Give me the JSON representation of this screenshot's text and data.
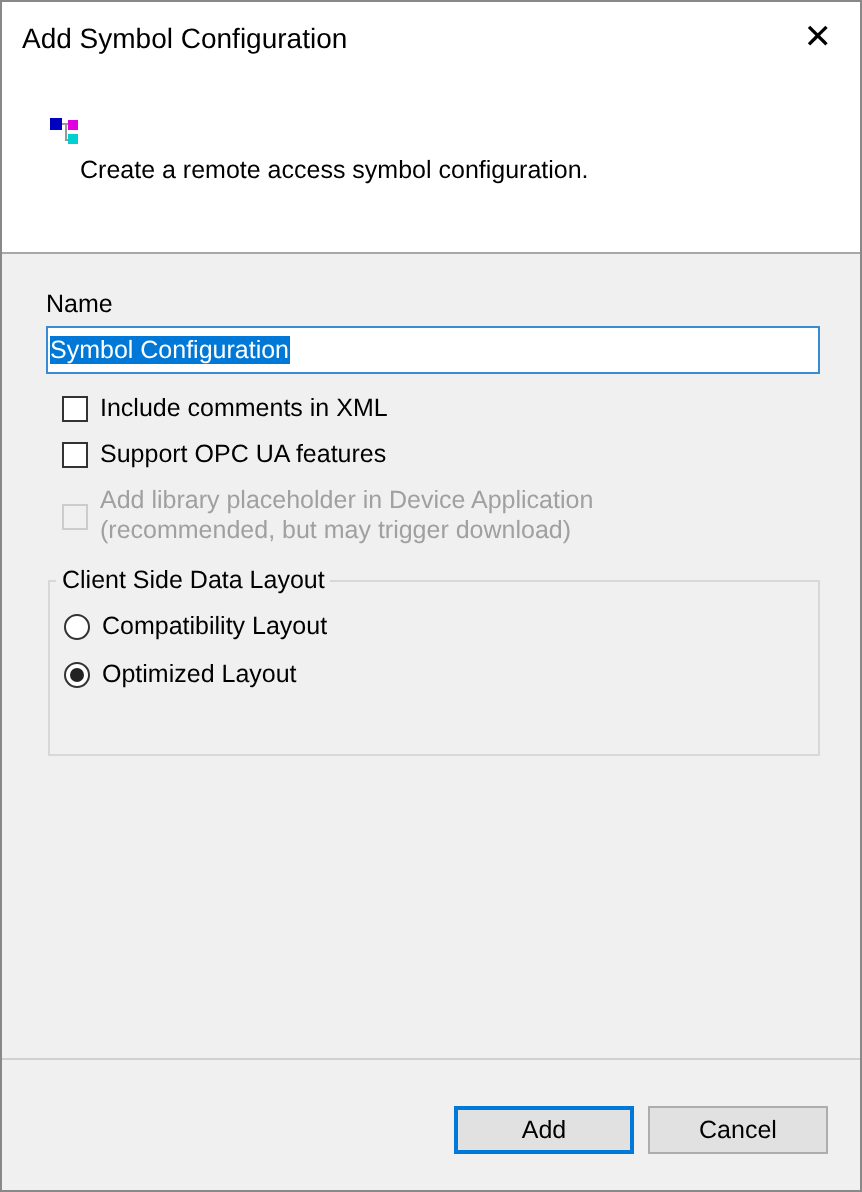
{
  "window": {
    "title": "Add Symbol Configuration",
    "close": "✕"
  },
  "header": {
    "description": "Create a remote access symbol configuration."
  },
  "name_field": {
    "label": "Name",
    "value": "Symbol Configuration",
    "selected": true
  },
  "options": [
    {
      "label": "Include comments in XML",
      "checked": false,
      "disabled": false
    },
    {
      "label": "Support OPC UA features",
      "checked": false,
      "disabled": false
    },
    {
      "label": "Add library placeholder in Device Application\n(recommended, but may trigger download)",
      "checked": false,
      "disabled": true
    }
  ],
  "layout_group": {
    "title": "Client Side Data Layout",
    "choices": [
      {
        "label": "Compatibility Layout",
        "selected": false
      },
      {
        "label": "Optimized Layout",
        "selected": true
      }
    ]
  },
  "buttons": [
    {
      "label": "Add",
      "default": true
    },
    {
      "label": "Cancel",
      "default": false
    }
  ]
}
